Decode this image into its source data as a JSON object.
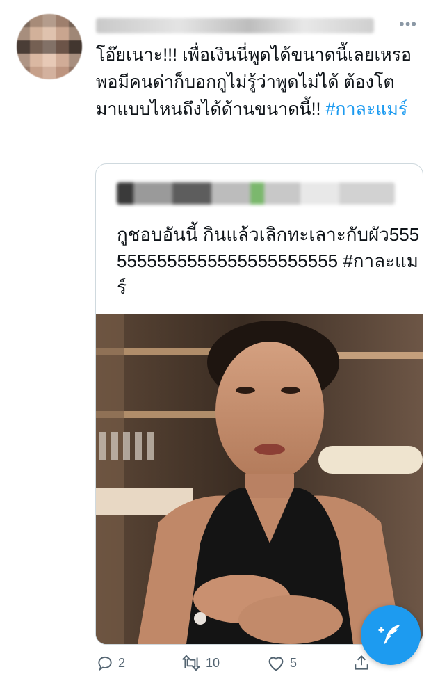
{
  "tweet": {
    "text_main": "โอ๊ยเนาะ!!! เพื่อเงินนี่พูดได้ขนาดนี้เลยเหรอ พอมีคนด่าก็บอกกูไม่รู้ว่าพูดไม่ได้ ต้องโตมาแบบไหนถึงได้ด้านขนาดนี้!! ",
    "hashtag": "#กาละแมร์"
  },
  "quote": {
    "text_main": "กูชอบอันนี้ กินแล้วเลิกทะเลาะกับผัว5555555555555555555555555 ",
    "hashtag": "#กาละแมร์"
  },
  "actions": {
    "reply_count": "2",
    "retweet_count": "10",
    "like_count": "5"
  },
  "icons": {
    "more": "more-icon",
    "reply": "reply-icon",
    "retweet": "retweet-icon",
    "like": "heart-icon",
    "share": "share-icon",
    "compose": "compose-feather-icon"
  },
  "colors": {
    "accent": "#1d9bf0",
    "muted": "#536471",
    "text": "#0f1419",
    "border": "#cfd9de"
  }
}
